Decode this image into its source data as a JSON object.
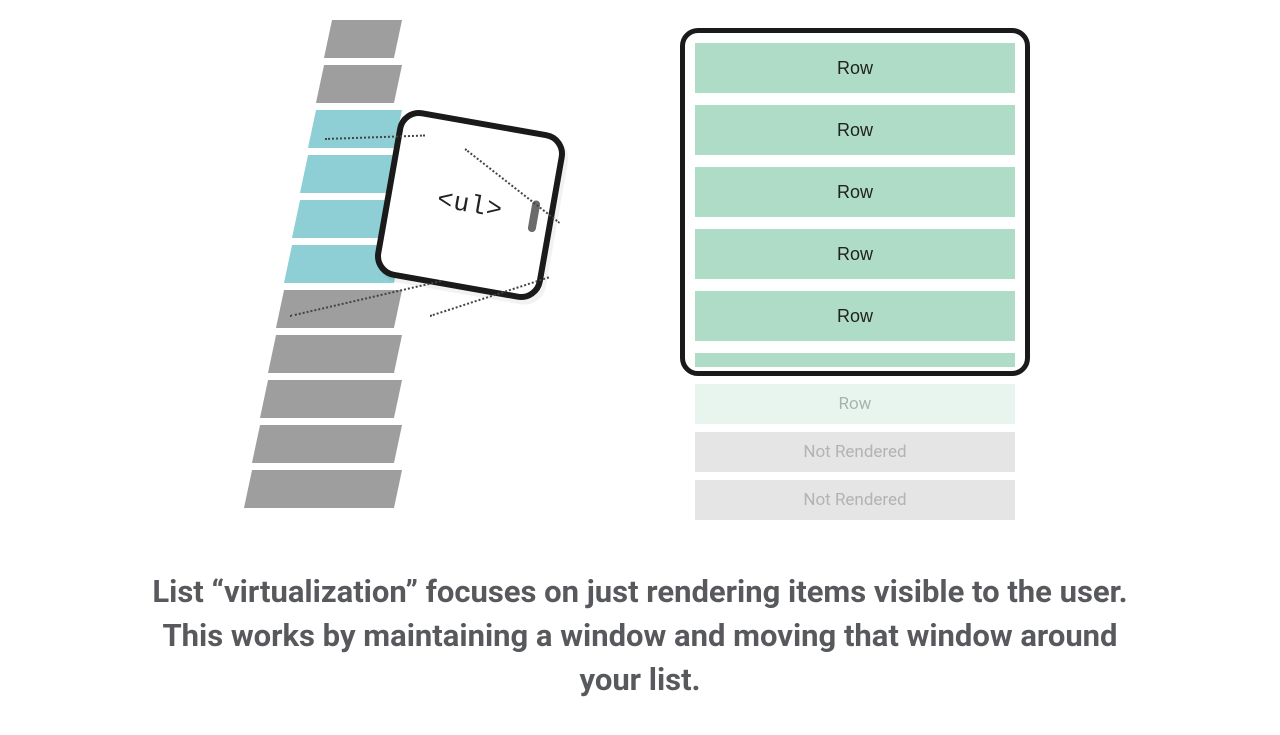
{
  "left": {
    "device_label": "<ul>",
    "bar_colors": [
      "gray",
      "gray",
      "teal",
      "teal",
      "teal",
      "teal",
      "gray",
      "gray",
      "gray",
      "gray",
      "gray"
    ]
  },
  "right": {
    "rendered_rows": [
      "Row",
      "Row",
      "Row",
      "Row",
      "Row"
    ],
    "buffered_row": "Row",
    "not_rendered": [
      "Not Rendered",
      "Not Rendered"
    ]
  },
  "caption": "List “virtualization” focuses on just rendering items visible to the user. This works by maintaining a window and moving that window around your list."
}
